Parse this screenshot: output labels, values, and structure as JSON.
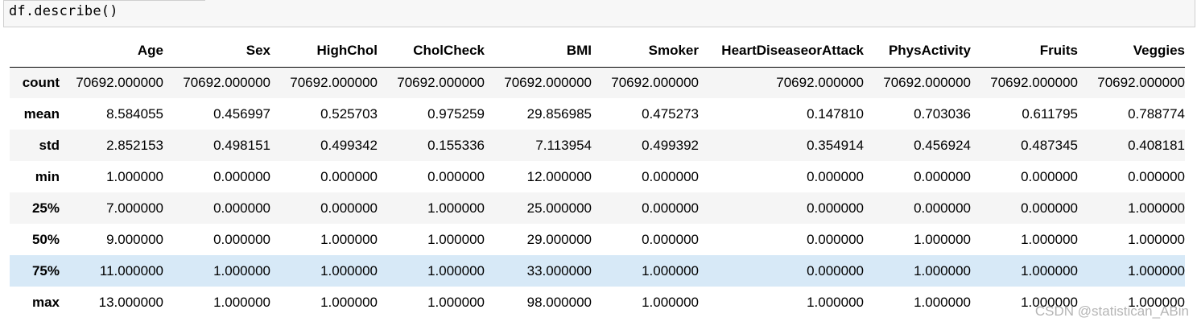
{
  "cell": {
    "code": "df.describe()"
  },
  "table": {
    "columns": [
      "Age",
      "Sex",
      "HighChol",
      "CholCheck",
      "BMI",
      "Smoker",
      "HeartDiseaseorAttack",
      "PhysActivity",
      "Fruits",
      "Veggies"
    ],
    "rows": [
      {
        "label": "count",
        "values": [
          "70692.000000",
          "70692.000000",
          "70692.000000",
          "70692.000000",
          "70692.000000",
          "70692.000000",
          "70692.000000",
          "70692.000000",
          "70692.000000",
          "70692.000000"
        ]
      },
      {
        "label": "mean",
        "values": [
          "8.584055",
          "0.456997",
          "0.525703",
          "0.975259",
          "29.856985",
          "0.475273",
          "0.147810",
          "0.703036",
          "0.611795",
          "0.788774"
        ]
      },
      {
        "label": "std",
        "values": [
          "2.852153",
          "0.498151",
          "0.499342",
          "0.155336",
          "7.113954",
          "0.499392",
          "0.354914",
          "0.456924",
          "0.487345",
          "0.408181"
        ]
      },
      {
        "label": "min",
        "values": [
          "1.000000",
          "0.000000",
          "0.000000",
          "0.000000",
          "12.000000",
          "0.000000",
          "0.000000",
          "0.000000",
          "0.000000",
          "0.000000"
        ]
      },
      {
        "label": "25%",
        "values": [
          "7.000000",
          "0.000000",
          "0.000000",
          "1.000000",
          "25.000000",
          "0.000000",
          "0.000000",
          "0.000000",
          "0.000000",
          "1.000000"
        ]
      },
      {
        "label": "50%",
        "values": [
          "9.000000",
          "0.000000",
          "1.000000",
          "1.000000",
          "29.000000",
          "0.000000",
          "0.000000",
          "1.000000",
          "1.000000",
          "1.000000"
        ]
      },
      {
        "label": "75%",
        "values": [
          "11.000000",
          "1.000000",
          "1.000000",
          "1.000000",
          "33.000000",
          "1.000000",
          "0.000000",
          "1.000000",
          "1.000000",
          "1.000000"
        ]
      },
      {
        "label": "max",
        "values": [
          "13.000000",
          "1.000000",
          "1.000000",
          "1.000000",
          "98.000000",
          "1.000000",
          "1.000000",
          "1.000000",
          "1.000000",
          "1.000000"
        ]
      }
    ],
    "highlighted_row": "75%"
  },
  "watermark": "CSDN @statistican_ABin",
  "colors": {
    "row_odd": "#f5f5f5",
    "row_even": "#ffffff",
    "row_hover": "#d7e9f7",
    "header_border": "#000000",
    "code_bg": "#f7f7f7"
  }
}
